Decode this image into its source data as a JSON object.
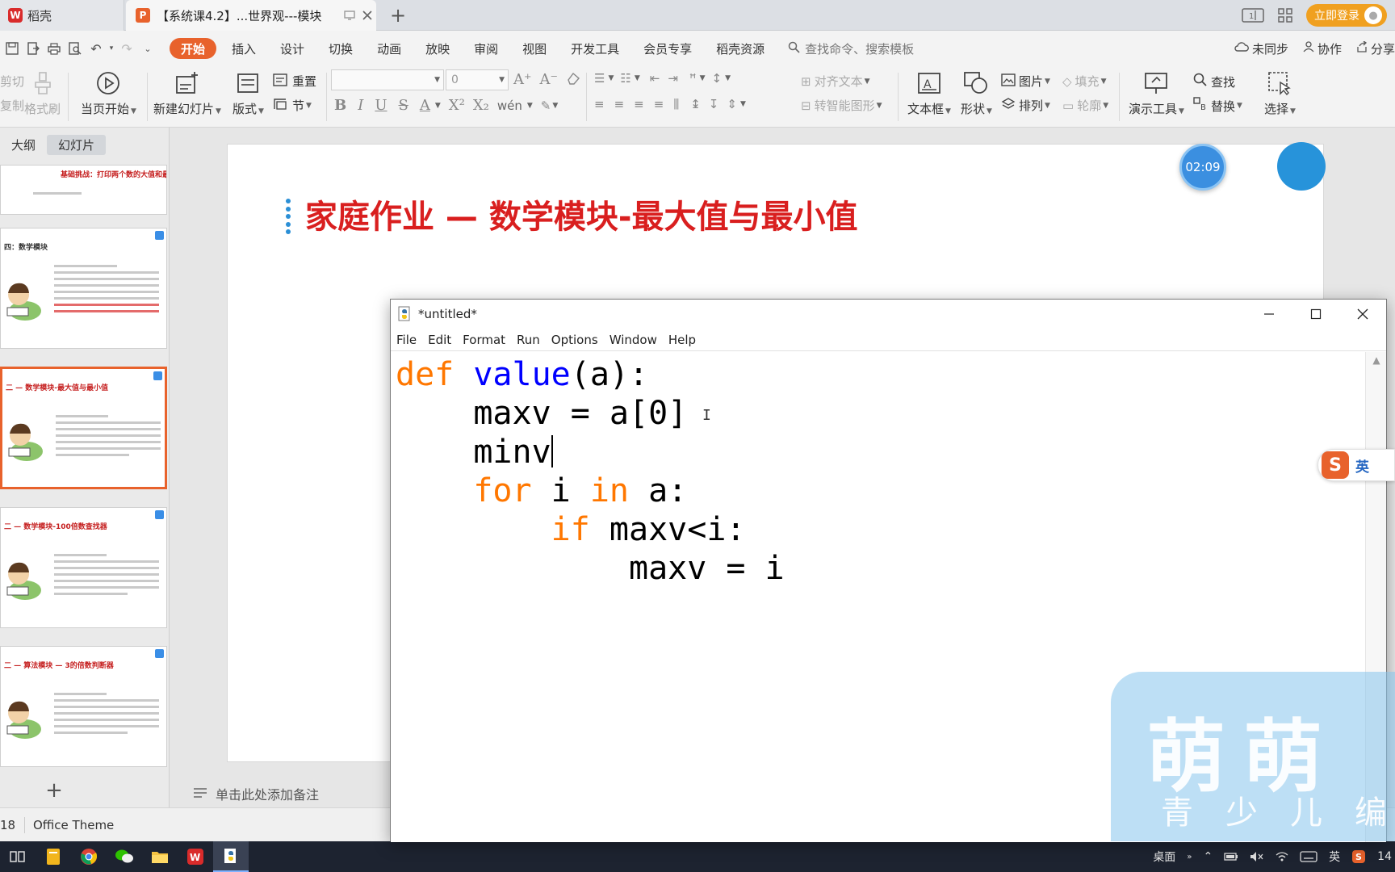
{
  "tabs": {
    "home": "稻壳",
    "doc": "【系统课4.2】...世界观---模块"
  },
  "topbar": {
    "login": "立即登录"
  },
  "menu": {
    "items": [
      "开始",
      "插入",
      "设计",
      "切换",
      "动画",
      "放映",
      "审阅",
      "视图",
      "开发工具",
      "会员专享",
      "稻壳资源"
    ],
    "search_placeholder": "查找命令、搜索模板",
    "sync": "未同步",
    "collab": "协作",
    "share": "分享"
  },
  "ribbon": {
    "cut": "剪切",
    "copy": "复制",
    "format_painter": "格式刷",
    "from_current": "当页开始",
    "new_slide": "新建幻灯片",
    "layout": "版式",
    "reset": "重置",
    "section": "节",
    "font_size": "0",
    "align_text": "对齐文本",
    "smartart": "转智能图形",
    "textbox": "文本框",
    "shape": "形状",
    "picture": "图片",
    "fill": "填充",
    "arrange": "排列",
    "outline": "轮廓",
    "present_tools": "演示工具",
    "find": "查找",
    "replace": "替换",
    "select": "选择"
  },
  "left_pane": {
    "tab_outline": "大纲",
    "tab_slides": "幻灯片",
    "thumbs": [
      {
        "title": "基础挑战：打印两个数的大值和最小值。"
      },
      {
        "title": "四：数学模块"
      },
      {
        "title": "二 — 数学模块-最大值与最小值"
      },
      {
        "title": "二 — 数学模块-100倍数查找器"
      },
      {
        "title": "二 — 算法模块 — 3的倍数判断器"
      }
    ]
  },
  "slide": {
    "title": "家庭作业  —  数学模块-最大值与最小值",
    "timer": "02:09"
  },
  "notes": {
    "placeholder": "单击此处添加备注"
  },
  "status": {
    "page": "18",
    "theme": "Office Theme"
  },
  "idle": {
    "title": "*untitled*",
    "menu": [
      "File",
      "Edit",
      "Format",
      "Run",
      "Options",
      "Window",
      "Help"
    ],
    "code": {
      "l1_kw": "def",
      "l1_fn": "value",
      "l1_rest": "(a):",
      "l2": "    maxv = a[0]",
      "l3": "    minv",
      "l4_indent": "    ",
      "l4_kw1": "for",
      "l4_mid": " i ",
      "l4_kw2": "in",
      "l4_rest": " a:",
      "l5_indent": "        ",
      "l5_kw": "if",
      "l5_rest": " maxv<i:",
      "l6": "            maxv = i"
    }
  },
  "ime": {
    "lang": "英"
  },
  "watermark": {
    "big": "萌萌",
    "small": "青少儿编"
  },
  "tray": {
    "desktop": "桌面",
    "lang": "英",
    "time": "14"
  }
}
